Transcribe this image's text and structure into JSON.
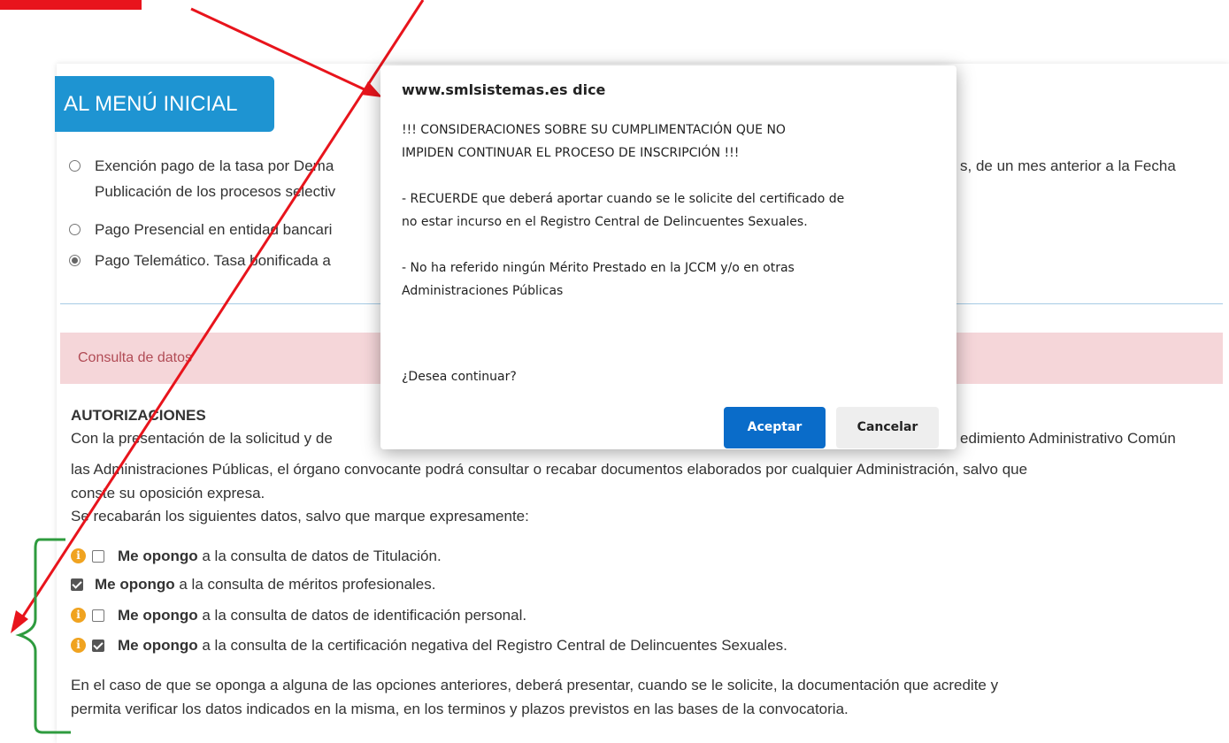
{
  "menu_button": {
    "label": "AL MENÚ INICIAL"
  },
  "payment_options": [
    {
      "line1": "Exención pago de la tasa por Dema",
      "line1_right": "s, de un mes anterior a la Fecha",
      "line2": "Publicación de los procesos selectiv",
      "checked": false
    },
    {
      "line1": "Pago Presencial en entidad bancari",
      "checked": false
    },
    {
      "line1": "Pago Telemático. Tasa bonificada a",
      "checked": true
    }
  ],
  "consulta": {
    "label": "Consulta de datos"
  },
  "autorizaciones": {
    "heading": "AUTORIZACIONES",
    "p1_left": "Con la presentación de la solicitud y de",
    "p1_right": "edimiento Administrativo Común",
    "p2": "las Administraciones Públicas, el órgano convocante podrá consultar o recabar documentos elaborados por cualquier Administración, salvo que",
    "p3": "conste su oposición expresa.",
    "p4": "Se recabarán los siguientes datos, salvo que marque expresamente:"
  },
  "oppose_options": [
    {
      "bold": "Me opongo",
      "text": " a la consulta de datos de Titulación.",
      "checked": false,
      "info": true
    },
    {
      "bold": "Me opongo",
      "text": " a la consulta de méritos profesionales.",
      "checked": true,
      "info": false
    },
    {
      "bold": "Me opongo",
      "text": " a la consulta de datos de identificación personal.",
      "checked": false,
      "info": true
    },
    {
      "bold": "Me opongo",
      "text": " a la consulta de la certificación negativa del Registro Central de Delincuentes Sexuales.",
      "checked": true,
      "info": true
    }
  ],
  "footer_text": {
    "line1": "En el caso de que se oponga a alguna de las opciones anteriores, deberá presentar, cuando se le solicite, la documentación que acredite y",
    "line2": "permita verificar los datos indicados en la misma, en los terminos y plazos previstos en las bases de la convocatoria."
  },
  "dialog": {
    "title": "www.smlsistemas.es dice",
    "para1_line1": "!!! CONSIDERACIONES SOBRE SU CUMPLIMENTACIÓN QUE NO",
    "para1_line2": "IMPIDEN CONTINUAR EL PROCESO DE INSCRIPCIÓN !!!",
    "para2_line1": "- RECUERDE que deberá aportar cuando se le solicite del certificado de",
    "para2_line2": "no estar incurso en el Registro Central de Delincuentes Sexuales.",
    "para3_line1": "- No ha referido ningún Mérito Prestado en la JCCM y/o en otras",
    "para3_line2": "Administraciones Públicas",
    "question": "¿Desea continuar?",
    "accept_label": "Aceptar",
    "cancel_label": "Cancelar"
  },
  "colors": {
    "menu_button": "#1e94d2",
    "accept_button": "#0a6cc9",
    "consulta_bar_bg": "#f5d6d9",
    "annotation_red": "#e8141c",
    "annotation_green": "#2e9b3e",
    "info_icon": "#f0a320"
  }
}
